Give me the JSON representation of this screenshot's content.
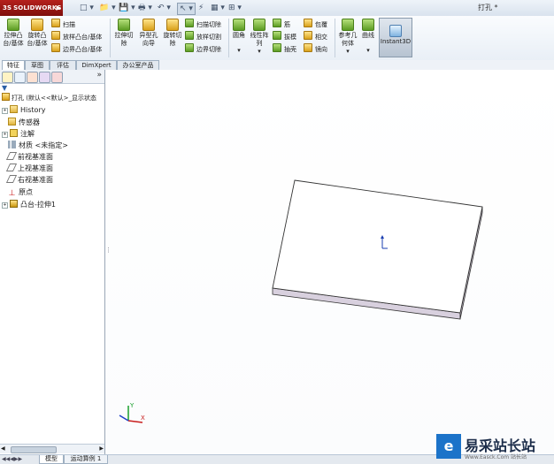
{
  "app": {
    "brand": "SOLIDWORKS",
    "brand_prefix": "3S",
    "menu_arrow": "▶"
  },
  "quick_access": {
    "items": [
      "□ ▾",
      "📁 ▾",
      "💾 ▾",
      "🖶 ▾",
      "↶ ▾",
      "↖ ▾",
      "⚡",
      "▦ ▾",
      "⊞ ▾"
    ]
  },
  "document_title": "打孔 *",
  "ribbon": {
    "big_buttons": [
      {
        "label": "拉伸凸台/基体",
        "icon": "boss-extrude-icon"
      },
      {
        "label": "旋转凸台/基体",
        "icon": "boss-revolve-icon"
      },
      {
        "label": "拉伸切除",
        "icon": "extruded-cut-icon"
      },
      {
        "label": "异型孔向导",
        "icon": "hole-wizard-icon"
      },
      {
        "label": "旋转切除",
        "icon": "revolved-cut-icon"
      },
      {
        "label": "圆角",
        "icon": "fillet-icon"
      },
      {
        "label": "线性阵列",
        "icon": "linear-pattern-icon"
      },
      {
        "label": "参考几何体",
        "icon": "reference-geometry-icon"
      },
      {
        "label": "曲线",
        "icon": "curves-icon"
      }
    ],
    "small_buttons": {
      "boss": [
        "扫描",
        "放样凸台/基体",
        "边界凸台/基体"
      ],
      "cut": [
        "扫描切除",
        "放样切割",
        "边界切除"
      ],
      "features_a": [
        "筋",
        "拔模",
        "抽壳"
      ],
      "features_b": [
        "包覆",
        "相交",
        "镜向"
      ]
    },
    "instant3d": "Instant3D",
    "dropdown_marker": "▾"
  },
  "tabs": [
    {
      "label": "特征",
      "active": true
    },
    {
      "label": "草图",
      "active": false
    },
    {
      "label": "评估",
      "active": false
    },
    {
      "label": "DimXpert",
      "active": false
    },
    {
      "label": "办公室产品",
      "active": false
    }
  ],
  "view_toolbar": "🔍🔍↯ 🗗▾ ⬚▾ ◐▾ ⚙▾ 🖥▾",
  "panel": {
    "collapse": "»",
    "filter_icon": "▼",
    "root": "打孔 (默认<<默认>_显示状态",
    "items": [
      {
        "label": "History",
        "icon": "folder",
        "expand": "+"
      },
      {
        "label": "传感器",
        "icon": "folder",
        "expand": ""
      },
      {
        "label": "注解",
        "icon": "annotation",
        "expand": "+"
      },
      {
        "label": "材质 <未指定>",
        "icon": "material",
        "expand": ""
      },
      {
        "label": "前视基准面",
        "icon": "plane",
        "expand": ""
      },
      {
        "label": "上视基准面",
        "icon": "plane",
        "expand": ""
      },
      {
        "label": "右视基准面",
        "icon": "plane",
        "expand": ""
      },
      {
        "label": "原点",
        "icon": "origin",
        "expand": ""
      },
      {
        "label": "凸台-拉伸1",
        "icon": "extrude",
        "expand": "+"
      }
    ]
  },
  "bottom_tabs": [
    {
      "label": "模型",
      "active": true
    },
    {
      "label": "运动算例 1",
      "active": false
    }
  ],
  "triad_labels": {
    "y": "Y",
    "x": "X"
  },
  "watermark": {
    "name": "易采站长站",
    "url": "Www.Easck.Com  站长站"
  },
  "colors": {
    "accent": "#b5211c",
    "face_top": "#ffffff",
    "face_side": "#c9bfd0",
    "face_front": "#d8d0de"
  }
}
